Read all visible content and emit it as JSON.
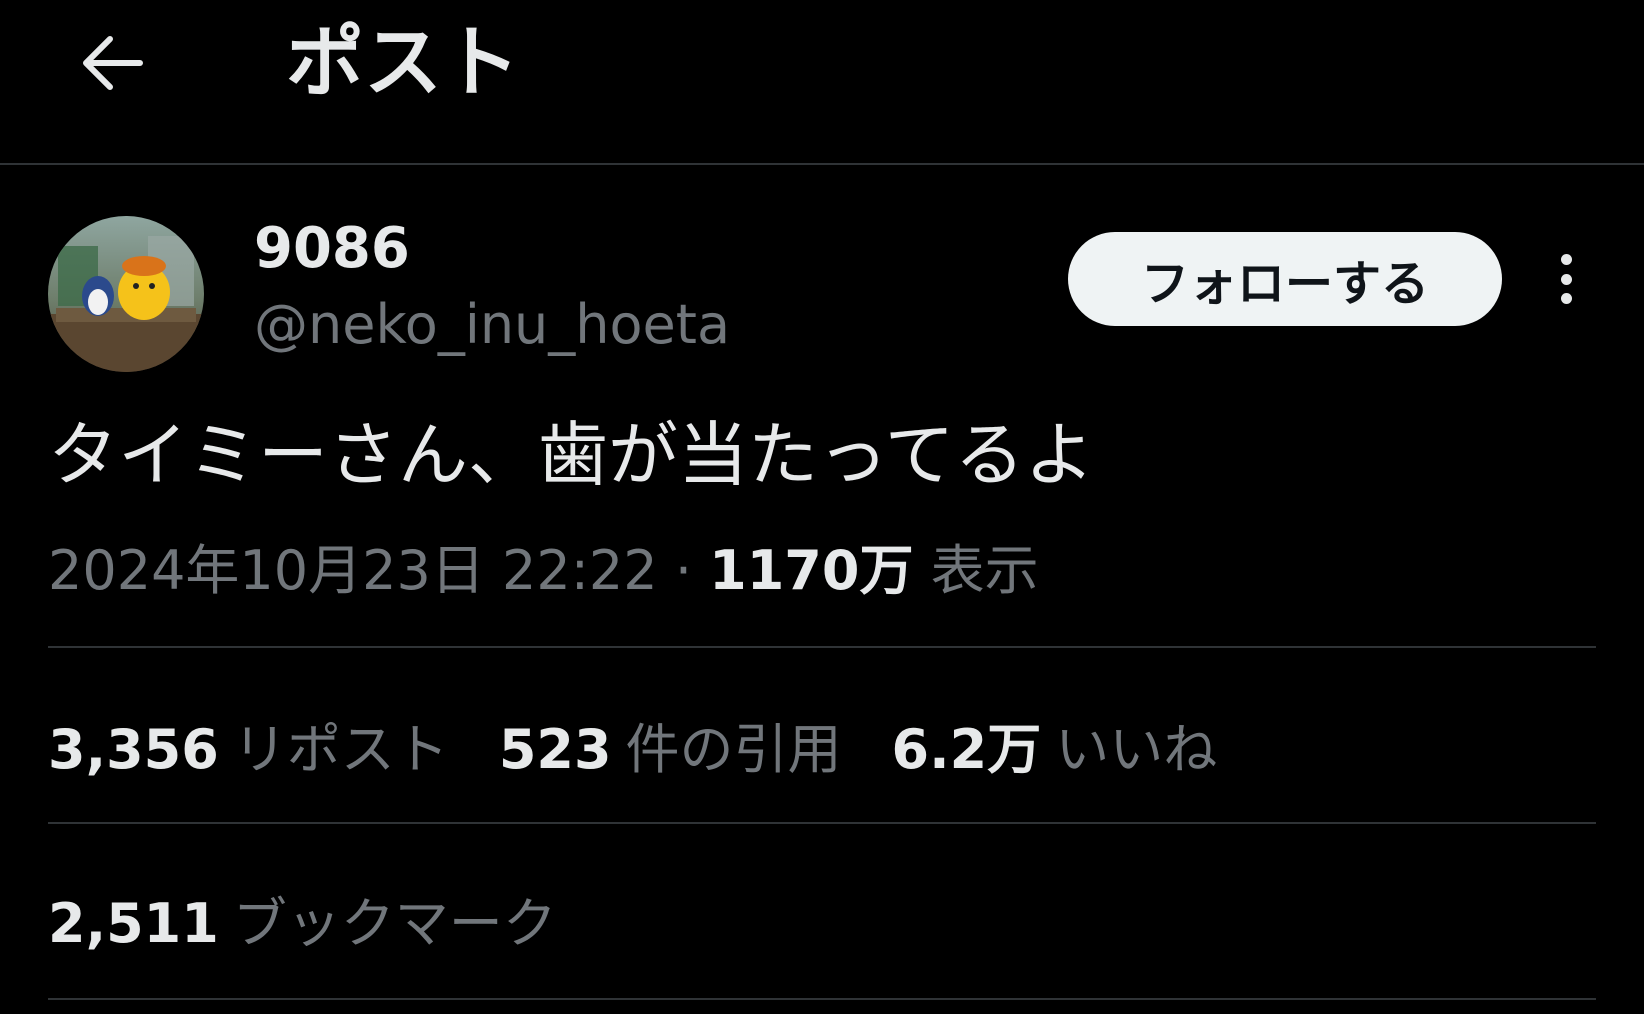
{
  "header": {
    "title": "ポスト",
    "back_icon": "arrow-left-icon"
  },
  "author": {
    "display_name": "9086",
    "handle": "@neko_inu_hoeta",
    "follow_label": "フォローする",
    "more_icon": "more-vertical-icon"
  },
  "post": {
    "text": "タイミーさん、歯が当たってるよ",
    "timestamp": "2024年10月23日 22:22",
    "separator": "·",
    "views_value": "1170万",
    "views_label": "表示"
  },
  "stats": {
    "reposts_value": "3,356",
    "reposts_label": "リポスト",
    "quotes_value": "523",
    "quotes_label": "件の引用",
    "likes_value": "6.2万",
    "likes_label": "いいね",
    "bookmarks_value": "2,511",
    "bookmarks_label": "ブックマーク"
  },
  "colors": {
    "background": "#000000",
    "primary_text": "#e7e9ea",
    "secondary_text": "#71767b",
    "divider": "#2f3336",
    "follow_button_bg": "#eff3f4"
  }
}
